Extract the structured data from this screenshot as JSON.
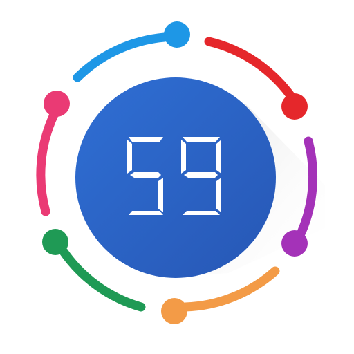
{
  "icon": {
    "display_value": "59",
    "colors": {
      "background": "#ffffff",
      "circle_fill": "#2a62c4",
      "digit": "#ffffff",
      "shadow": "#e6e6e6",
      "ring_blue": "#1e97e6",
      "ring_red": "#e5272b",
      "ring_purple": "#a432b8",
      "ring_orange": "#f39b47",
      "ring_green": "#1f9a55",
      "ring_pink": "#ea3a74"
    }
  }
}
